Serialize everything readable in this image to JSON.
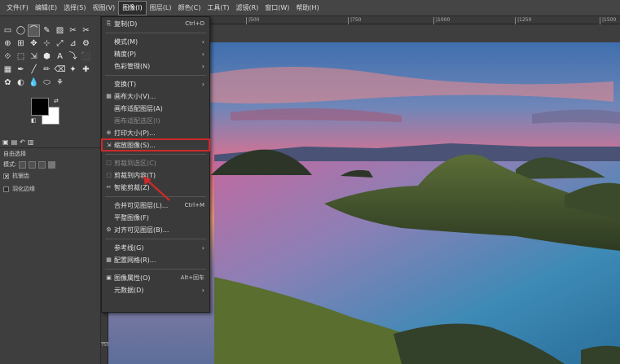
{
  "menubar": [
    "文件(F)",
    "编辑(E)",
    "选择(S)",
    "视图(V)",
    "图像(I)",
    "图层(L)",
    "颜色(C)",
    "工具(T)",
    "滤镜(R)",
    "窗口(W)",
    "帮助(H)"
  ],
  "menubar_active_index": 4,
  "toolbox": {
    "tools": [
      "▭",
      "◯",
      "⌒",
      "✎",
      "▨",
      "✂",
      "✂",
      "⊕",
      "⊞",
      "✥",
      "⊹",
      "⤢",
      "⊿",
      "⚙",
      "⟐",
      "⬚",
      "⇲",
      "⬢",
      "A",
      "⤵",
      "⬛",
      "▦",
      "✒",
      "╱",
      "✏",
      "⌫",
      "✦",
      "✚",
      "✿",
      "◐",
      "💧",
      "⬭",
      "⚘"
    ],
    "colors": {
      "fg": "#000000",
      "bg": "#ffffff"
    }
  },
  "tool_options": {
    "title": "自由选择",
    "mode_label": "模式:",
    "antialias": "抗锯齿",
    "feather": "羽化边缘"
  },
  "ruler_top": [
    "|500",
    "|750",
    "|1000",
    "|1250",
    "|1500"
  ],
  "ruler_left": [
    "250",
    "500",
    "750"
  ],
  "image_menu": [
    {
      "icon": "⎘",
      "label": "复制(D)",
      "shortcut": "Ctrl+D"
    },
    {
      "sep": true
    },
    {
      "label": "模式(M)",
      "submenu": true
    },
    {
      "label": "精度(P)",
      "submenu": true
    },
    {
      "label": "色彩管理(N)",
      "submenu": true
    },
    {
      "sep": true
    },
    {
      "label": "变换(T)",
      "submenu": true
    },
    {
      "icon": "▦",
      "label": "画布大小(V)..."
    },
    {
      "label": "画布适配图层(A)"
    },
    {
      "label": "画布适配选区(I)",
      "disabled": true
    },
    {
      "icon": "⊕",
      "label": "打印大小(P)..."
    },
    {
      "icon": "⇲",
      "label": "缩放图像(S)...",
      "highlight": true
    },
    {
      "sep": true
    },
    {
      "icon": "⬚",
      "label": "剪裁到选区(C)",
      "disabled": true
    },
    {
      "icon": "⬚",
      "label": "剪裁到内容(T)"
    },
    {
      "icon": "✂",
      "label": "智能剪裁(Z)"
    },
    {
      "sep": true
    },
    {
      "label": "合并可见图层(L)...",
      "shortcut": "Ctrl+M"
    },
    {
      "label": "平整图像(F)"
    },
    {
      "icon": "⚙",
      "label": "对齐可见图层(B)..."
    },
    {
      "sep": true
    },
    {
      "label": "参考线(G)",
      "submenu": true
    },
    {
      "icon": "▦",
      "label": "配置网格(R)..."
    },
    {
      "sep": true
    },
    {
      "icon": "▣",
      "label": "图像属性(O)",
      "shortcut": "Alt+回车"
    },
    {
      "label": "元数据(D)",
      "submenu": true
    }
  ]
}
